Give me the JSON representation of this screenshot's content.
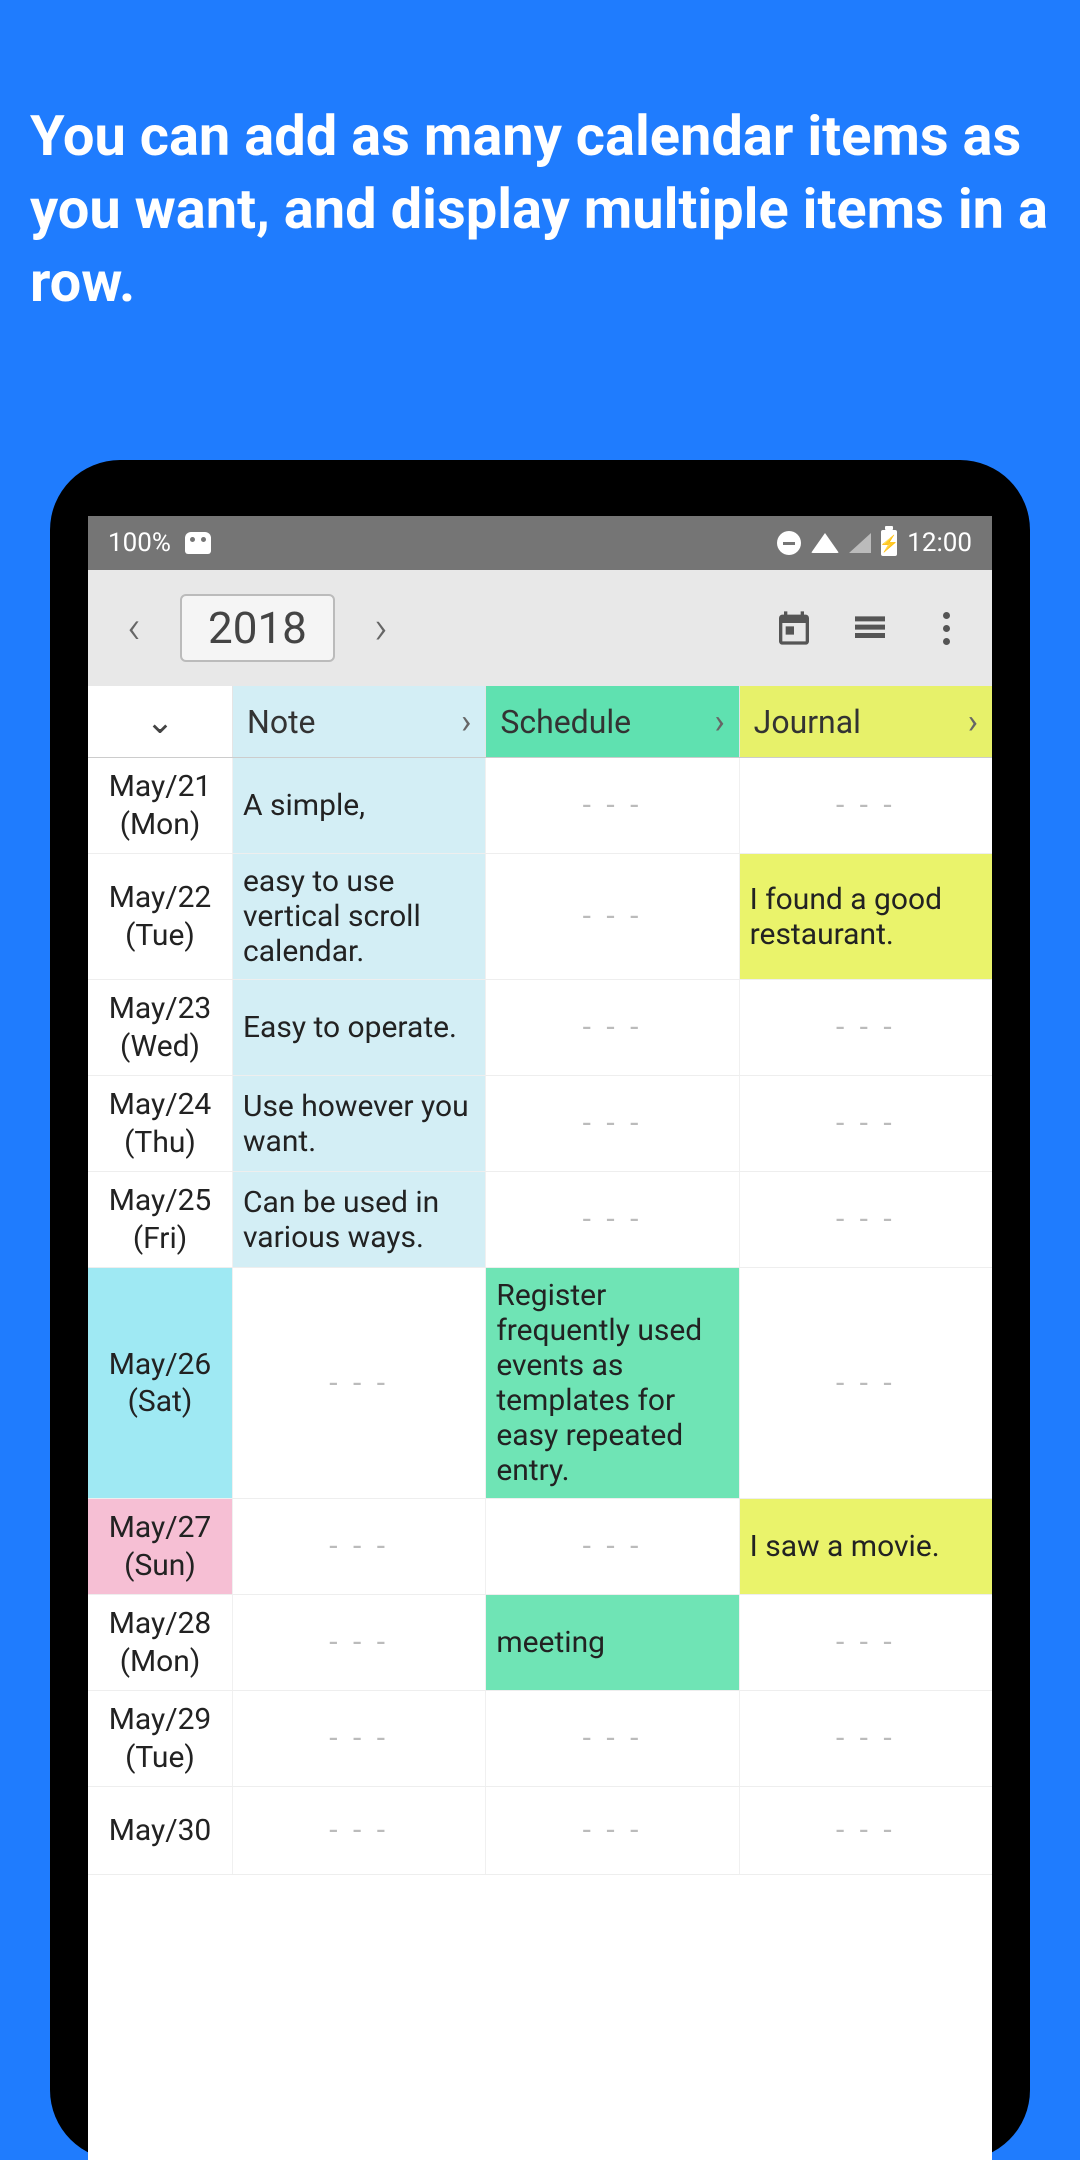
{
  "promo": "You can add as many calendar items as you want, and display multiple items in a row.",
  "status": {
    "battery_pct": "100%",
    "time": "12:00",
    "batt_glyph": "⚡"
  },
  "toolbar": {
    "year": "2018"
  },
  "headers": {
    "note": "Note",
    "schedule": "Schedule",
    "journal": "Journal"
  },
  "empty": "- - -",
  "rows": [
    {
      "d1": "May/21",
      "d2": "(Mon)",
      "note": "A simple,",
      "sched": "",
      "journal": ""
    },
    {
      "d1": "May/22",
      "d2": "(Tue)",
      "note": "easy to use vertical scroll calendar.",
      "sched": "",
      "journal": "I found a good restaurant."
    },
    {
      "d1": "May/23",
      "d2": "(Wed)",
      "note": "Easy to operate.",
      "sched": "",
      "journal": ""
    },
    {
      "d1": "May/24",
      "d2": "(Thu)",
      "note": "Use however you want.",
      "sched": "",
      "journal": ""
    },
    {
      "d1": "May/25",
      "d2": "(Fri)",
      "note": "Can be used in various ways.",
      "sched": "",
      "journal": ""
    },
    {
      "d1": "May/26",
      "d2": "(Sat)",
      "note": "",
      "sched": "Register frequently used events as templates for easy repeated entry.",
      "journal": "",
      "sat": true
    },
    {
      "d1": "May/27",
      "d2": "(Sun)",
      "note": "",
      "sched": "",
      "journal": "I saw a movie.",
      "sun": true
    },
    {
      "d1": "May/28",
      "d2": "(Mon)",
      "note": "",
      "sched": "meeting",
      "journal": ""
    },
    {
      "d1": "May/29",
      "d2": "(Tue)",
      "note": "",
      "sched": "",
      "journal": ""
    },
    {
      "d1": "May/30",
      "d2": "",
      "note": "",
      "sched": "",
      "journal": ""
    }
  ]
}
